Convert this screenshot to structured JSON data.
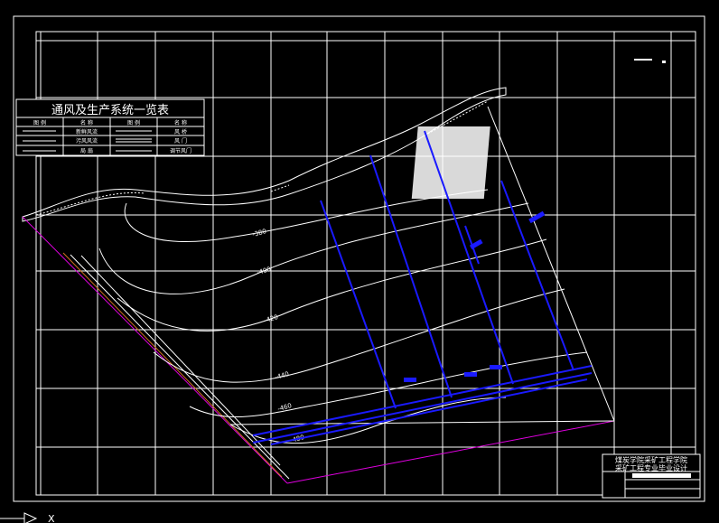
{
  "legend": {
    "title": "通风及生产系统一览表",
    "headers": [
      "图 例",
      "名 称",
      "图 例",
      "名 称"
    ],
    "rows": [
      [
        "新鲜风流",
        "风 桥"
      ],
      [
        "污风风流",
        "风 门"
      ],
      [
        "局 扇",
        "调节风门"
      ]
    ]
  },
  "contours": [
    "-380",
    "-400",
    "-420",
    "-440",
    "-460",
    "-480"
  ],
  "title_block": {
    "line1": "煤炭学院采矿工程学院",
    "line2": "采矿工程专业毕业设计"
  },
  "axis_indicator": "X",
  "colors": {
    "background": "#000000",
    "lines": "#ffffff",
    "roadway": "#1a1aff",
    "boundary": "#e000e0",
    "fault": "#d07020"
  }
}
